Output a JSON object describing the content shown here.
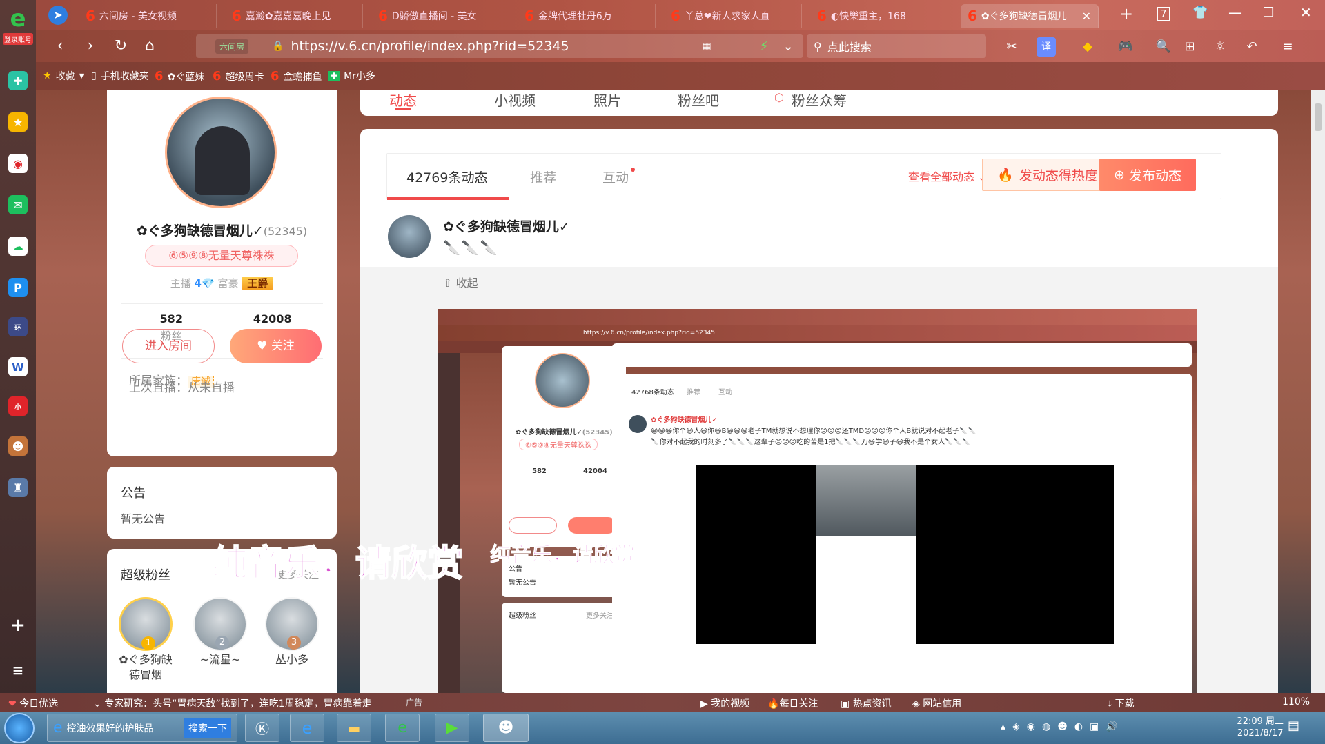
{
  "browser": {
    "sidebar_login_label": "登录账号",
    "tabs": [
      {
        "label": "六间房 - 美女视频"
      },
      {
        "label": "嘉瀚✿嘉嘉嘉晚上见"
      },
      {
        "label": "D骄傲直播间 - 美女"
      },
      {
        "label": "金牌代理牡丹6万"
      },
      {
        "label": "丫总❤新人求家人直"
      },
      {
        "label": "◐快樂重主，168"
      },
      {
        "label": "✿ぐ多狗缺德冒烟儿"
      }
    ],
    "url": "https://v.6.cn/profile/index.php?rid=52345",
    "url_site_tag": "六间房",
    "search_placeholder": "点此搜索",
    "bookmarks": [
      "收藏",
      "手机收藏夹",
      "✿ぐ蓝妹",
      "超级周卡",
      "金蟾捕鱼",
      "Mr小多"
    ]
  },
  "profile": {
    "name": "✿ぐ多狗缺德冒烟儿✓",
    "rid": "(52345)",
    "tag": "⑥⑤⑨⑧无量天尊祩祩",
    "anchor_label": "主播",
    "anchor_level": "4",
    "rich_label": "富豪",
    "rich_badge": "王爵",
    "fans_count": "582",
    "fans_label": "粉丝",
    "visits_count": "42008",
    "visits_label": "访问",
    "family_label": "所属家族：",
    "family_value": "唐诚",
    "last_live": "上次直播：从未直播",
    "enter_room": "进入房间",
    "follow": "关注"
  },
  "notice": {
    "title": "公告",
    "text": "暂无公告"
  },
  "fans": {
    "title": "超级粉丝",
    "more": "更多关注",
    "items": [
      {
        "name": "✿ぐ多狗缺德冒烟",
        "rank": "1"
      },
      {
        "name": "~流星~",
        "rank": "2"
      },
      {
        "name": "丛小多",
        "rank": "3"
      }
    ]
  },
  "top_tabs": [
    "动态",
    "小视频",
    "照片",
    "粉丝吧",
    "粉丝众筹"
  ],
  "feed": {
    "tabs": [
      "42769条动态",
      "推荐",
      "互动"
    ],
    "view_all": "查看全部动态",
    "hot_button": "发动态得热度",
    "publish_button": "发布动态",
    "author": "✿ぐ多狗缺德冒烟儿✓",
    "collapse": "收起"
  },
  "nested": {
    "url": "https://v.6.cn/profile/index.php?rid=52345",
    "tabs": [
      "42768条动态",
      "推荐",
      "互动"
    ],
    "author": "✿ぐ多狗缺德冒烟儿✓",
    "post_text_1": "😀😀😀你个😃人😃你😃B😀😀😀老子TM就想说不想理你😡😡😡还TMD😡😡😡你个人B就说对不起老子🔪🔪",
    "post_text_2": "🔪你对不起我的时刻多了🔪🔪🔪这辈子😡😡😡吃的苦是1把🔪🔪🔪刀😃学😃子😃我不是个女人🔪🔪🔪",
    "name_small": "✿ぐ多狗缺德冒烟儿✓",
    "rid_small": "(52345)",
    "tag_small": "⑥⑤⑨⑧无量天尊祩祩",
    "fans_small": "582",
    "visits_small": "42004",
    "notice_small": "公告",
    "notice_text_small": "暂无公告",
    "fans_title_small": "超级粉丝",
    "more_small": "更多关注"
  },
  "subtitle": {
    "big": "纯音乐，请欣赏",
    "small": "纯音乐，请欣赏"
  },
  "statusbar": {
    "left": "今日优选",
    "news": "专家研究：头号“胃病天敌”找到了，连吃1周稳定，胃病靠着走",
    "ad": "广告",
    "items": [
      "我的视频",
      "每日关注",
      "热点资讯",
      "网站信用",
      "下载"
    ],
    "zoom": "110%"
  },
  "taskbar": {
    "task1": "控油效果好的护肤品",
    "task1_btn": "搜索一下",
    "time": "22:09 周二",
    "date": "2021/8/17"
  }
}
